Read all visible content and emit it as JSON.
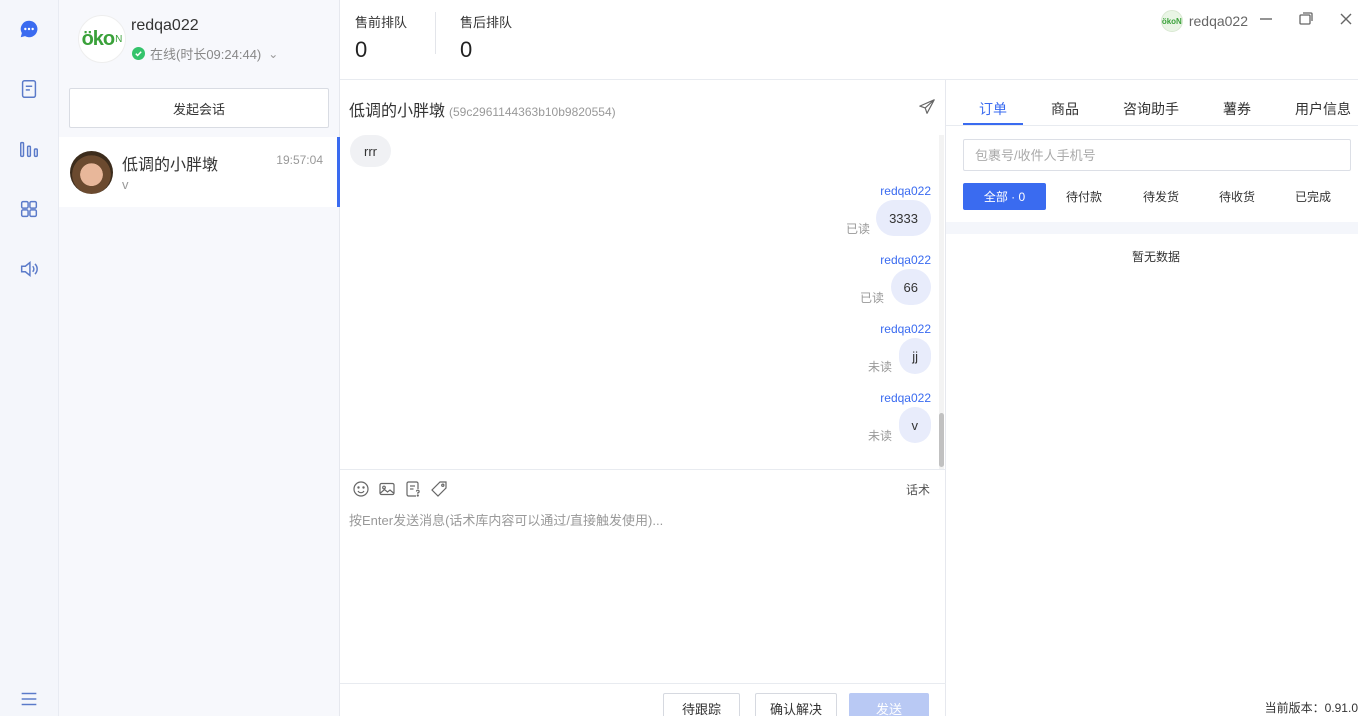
{
  "rail": {
    "icons": [
      "chat-bubble-icon",
      "document-icon",
      "bar-chart-icon",
      "apps-grid-icon",
      "speaker-icon",
      "menu-icon"
    ],
    "active_color": "#3a6bf0"
  },
  "profile": {
    "logo_text": "öko",
    "logo_sub": "N",
    "name": "redqa022",
    "status": "在线(时长09:24:44)"
  },
  "contacts": {
    "start_button": "发起会话",
    "items": [
      {
        "name": "低调的小胖墩",
        "time": "19:57:04",
        "last_message": "v"
      }
    ]
  },
  "header": {
    "presale_label": "售前排队",
    "presale_count": "0",
    "aftersale_label": "售后排队",
    "aftersale_count": "0",
    "user": "redqa022",
    "user_avatar_text": "ökoN"
  },
  "chat": {
    "title": "低调的小胖墩",
    "id": "(59c2961144363b10b9820554)",
    "incoming": "rrr",
    "messages": [
      {
        "sender": "redqa022",
        "text": "3333",
        "state": "已读"
      },
      {
        "sender": "redqa022",
        "text": "66",
        "state": "已读"
      },
      {
        "sender": "redqa022",
        "text": "jj",
        "state": "未读"
      },
      {
        "sender": "redqa022",
        "text": "v",
        "state": "未读"
      }
    ],
    "huashu": "话术",
    "placeholder": "按Enter发送消息(话术库内容可以通过/直接触发使用)...",
    "follow_button": "待跟踪",
    "resolve_button": "确认解决",
    "send_button": "发送"
  },
  "side": {
    "tabs": [
      "订单",
      "商品",
      "咨询助手",
      "薯券",
      "用户信息"
    ],
    "search_placeholder": "包裹号/收件人手机号",
    "filters": [
      "全部 · 0",
      "待付款",
      "待发货",
      "待收货",
      "已完成"
    ],
    "empty_text": "暂无数据",
    "version": "当前版本：0.91.0"
  },
  "colors": {
    "accent": "#3a6bf0",
    "online": "#34c36b",
    "bubble_out": "#e8ecfb",
    "bubble_in": "#f0f1f4"
  }
}
